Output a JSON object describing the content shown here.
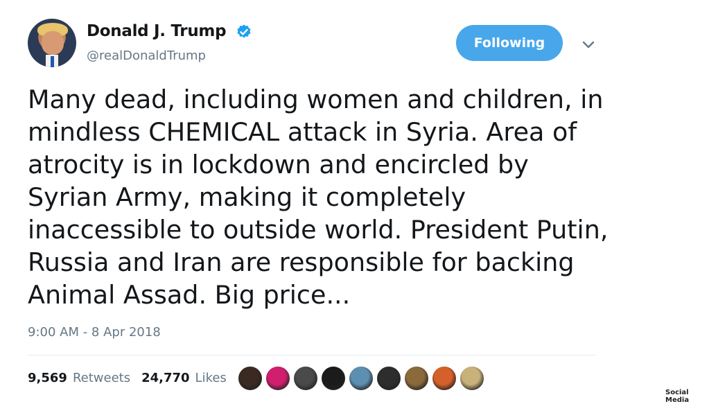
{
  "author": {
    "name": "Donald J. Trump",
    "handle": "@realDonaldTrump",
    "verified_icon": "verified-badge-icon"
  },
  "follow_button": {
    "label": "Following"
  },
  "menu": {
    "icon": "chevron-down-icon"
  },
  "tweet": {
    "lines": [
      "Many dead, including women and children, in",
      "mindless CHEMICAL attack in Syria. Area of",
      "atrocity is in lockdown and encircled by",
      "Syrian Army, making it completely",
      "inaccessible to outside world. President Putin,",
      "Russia and Iran are responsible for backing",
      "Animal Assad. Big price..."
    ]
  },
  "timestamp": "9:00 AM - 8 Apr 2018",
  "stats": {
    "retweets_count": "9,569",
    "retweets_label": "Retweets",
    "likes_count": "24,770",
    "likes_label": "Likes"
  },
  "likers": {
    "count_shown": 9,
    "colors": [
      "#3a2a22",
      "#d01f6e",
      "#4a4a4a",
      "#1b1b1b",
      "#5c8fb0",
      "#2d2d2d",
      "#8a6a3a",
      "#d5602a",
      "#c9b27a"
    ]
  },
  "watermark": "Social Media",
  "colors": {
    "accent": "#48a7ea",
    "verified": "#1da1f2",
    "muted": "#657786",
    "text": "#14171a"
  }
}
